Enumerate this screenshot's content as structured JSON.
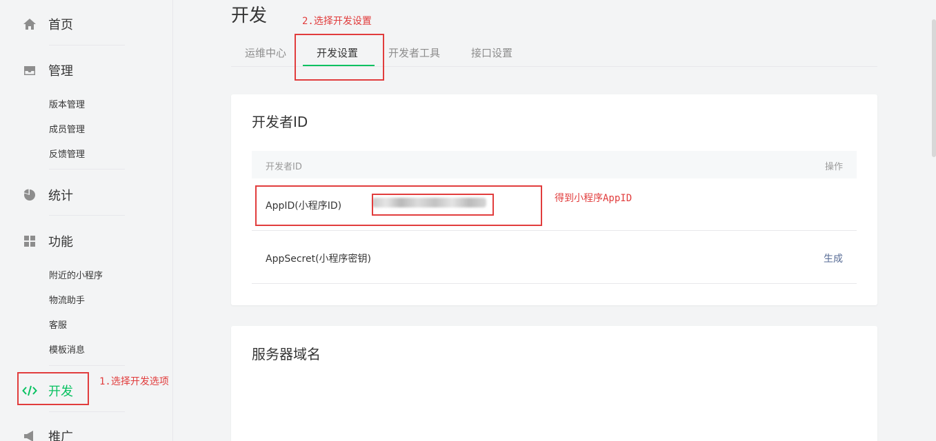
{
  "sidebar": {
    "home": "首页",
    "manage": "管理",
    "manage_items": [
      "版本管理",
      "成员管理",
      "反馈管理"
    ],
    "stats": "统计",
    "features": "功能",
    "feature_items": [
      "附近的小程序",
      "物流助手",
      "客服",
      "模板消息"
    ],
    "develop": "开发",
    "promote": "推广"
  },
  "page": {
    "title": "开发",
    "tabs": [
      "运维中心",
      "开发设置",
      "开发者工具",
      "接口设置"
    ],
    "active_tab": "开发设置"
  },
  "developer_id": {
    "title": "开发者ID",
    "col_name": "开发者ID",
    "col_action": "操作",
    "rows": [
      {
        "label": "AppID(小程序ID)",
        "value": "",
        "action": ""
      },
      {
        "label": "AppSecret(小程序密钥)",
        "value": "",
        "action": "生成"
      }
    ]
  },
  "server_domain": {
    "title": "服务器域名"
  },
  "annotations": {
    "step1": "1.选择开发选项",
    "step2": "2.选择开发设置",
    "appid_note": "得到小程序AppID"
  },
  "colors": {
    "accent": "#07c160",
    "annotation": "#e13c3c",
    "link": "#576b95"
  }
}
